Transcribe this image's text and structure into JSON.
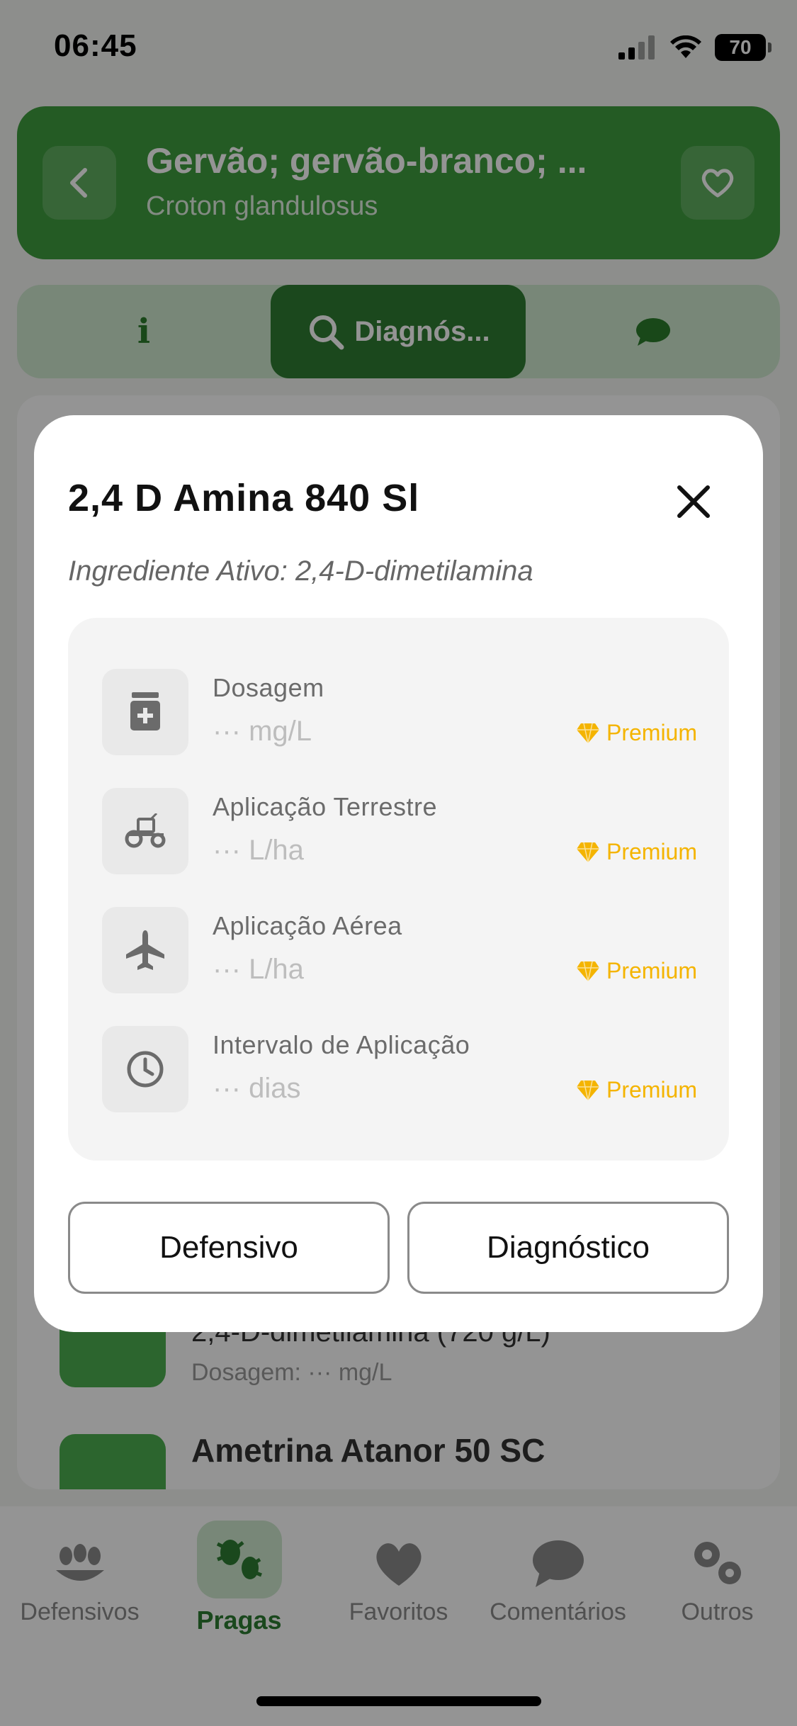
{
  "status_bar": {
    "time": "06:45",
    "battery": "70"
  },
  "header": {
    "title": "Gervão; gervão-branco; ...",
    "subtitle": "Croton glandulosus"
  },
  "tabs": {
    "info_label": "i",
    "diagnostics_label": "Diagnós..."
  },
  "background_list": [
    {
      "title": "2,4-D-dimetilamina (720 g/L)",
      "subtitle": "Dosagem: ··· mg/L"
    },
    {
      "title": "Ametrina Atanor 50 SC"
    }
  ],
  "modal": {
    "title": "2,4 D Amina 840 Sl",
    "ingredient": "Ingrediente Ativo: 2,4-D-dimetilamina",
    "rows": [
      {
        "label": "Dosagem",
        "value": "··· mg/L",
        "premium": "Premium",
        "icon": "medicine-icon"
      },
      {
        "label": "Aplicação Terrestre",
        "value": "··· L/ha",
        "premium": "Premium",
        "icon": "tractor-icon"
      },
      {
        "label": "Aplicação Aérea",
        "value": "··· L/ha",
        "premium": "Premium",
        "icon": "airplane-icon"
      },
      {
        "label": "Intervalo de Aplicação",
        "value": "··· dias",
        "premium": "Premium",
        "icon": "clock-icon"
      }
    ],
    "buttons": {
      "defensivo": "Defensivo",
      "diagnostico": "Diagnóstico"
    }
  },
  "bottom_nav": [
    {
      "label": "Defensivos",
      "icon": "grain-icon"
    },
    {
      "label": "Pragas",
      "icon": "bugs-icon",
      "active": true
    },
    {
      "label": "Favoritos",
      "icon": "heart-icon"
    },
    {
      "label": "Comentários",
      "icon": "chat-icon"
    },
    {
      "label": "Outros",
      "icon": "gears-icon"
    }
  ],
  "colors": {
    "primary": "#3e9d3e",
    "dark_green": "#2f7d32",
    "premium": "#f4b400"
  }
}
